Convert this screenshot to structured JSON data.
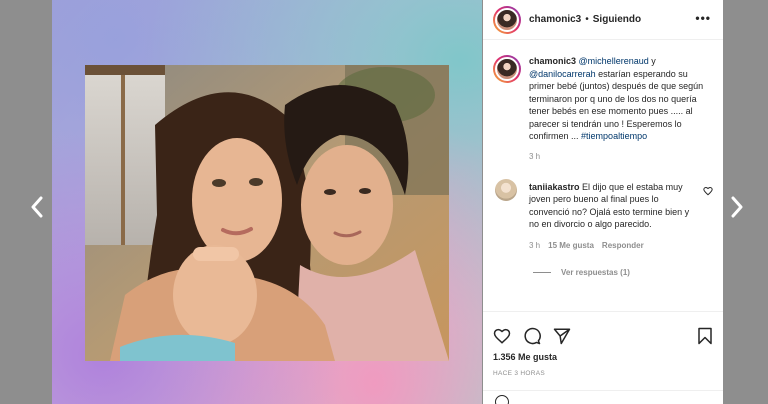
{
  "post": {
    "username": "chamonic3",
    "separator": "•",
    "follow_status": "Siguiendo",
    "more_label": "•••"
  },
  "caption": {
    "username": "chamonic3",
    "mention1": "@michellerenaud",
    "and": " y",
    "mention2": "@danilocarrerah",
    "text": " estarían esperando su primer bebé (juntos) después de que según terminaron por q uno de los dos no quería tener bebés en ese momento pues ..... al parecer si tendrán uno ! Esperemos lo confirmen ...",
    "hashtag": "#tiempoaltiempo",
    "time": "3 h"
  },
  "comment": {
    "username": "taniiakastro",
    "text": "El dijo que el estaba muy joven pero bueno al final pues lo convenció no? Ojalá esto termine bien y no en divorcio o algo parecido.",
    "time": "3 h",
    "likes": "15 Me gusta",
    "reply": "Responder",
    "view_replies": "Ver respuestas (1)"
  },
  "engagement": {
    "likes": "1.356 Me gusta",
    "posted": "HACE 3 HORAS"
  },
  "icons": {
    "prev": "chevron-left-icon",
    "next": "chevron-right-icon",
    "like": "heart-icon",
    "comment": "comment-icon",
    "share": "paper-plane-icon",
    "save": "bookmark-icon",
    "more": "more-icon",
    "emoji": "smiley-icon"
  },
  "colors": {
    "text": "#262626",
    "muted": "#8e8e8e",
    "link": "#00376b",
    "backdrop": "#8e8e8e"
  }
}
